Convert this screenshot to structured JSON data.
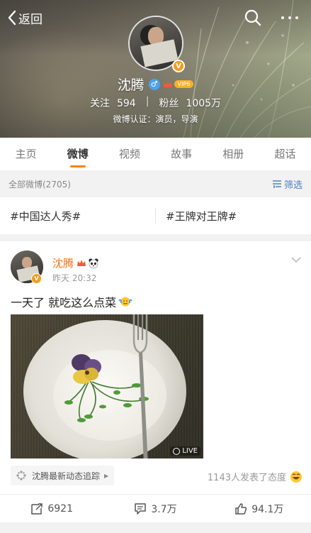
{
  "header": {
    "back_label": "返回",
    "profile_name": "沈腾",
    "gender_symbol": "♂",
    "vip_label": "VIP6",
    "following_label": "关注",
    "following_count": "594",
    "separator": "|",
    "followers_label": "粉丝",
    "followers_count": "1005万",
    "verification": "微博认证：演员，导演"
  },
  "tabs": [
    "主页",
    "微博",
    "视频",
    "故事",
    "相册",
    "超话"
  ],
  "active_tab": "微博",
  "filter": {
    "count_label": "全部微博(2705)",
    "filter_label": "筛选"
  },
  "topics": [
    "#中国达人秀#",
    "#王牌对王牌#"
  ],
  "post": {
    "author": "沈腾",
    "time": "昨天 20:32",
    "text": "一天了 就吃这么点菜",
    "live_label": "LIVE",
    "tracker_label": "沈腾最新动态追踪",
    "attitude_text": "1143人发表了态度",
    "repost_count": "6921",
    "comment_count": "3.7万",
    "like_count": "94.1万"
  },
  "colors": {
    "accent_orange": "#ff8200",
    "name_orange": "#f3730e",
    "link_blue": "#4a7ec5",
    "verified_badge": "#f29d1f"
  },
  "icons": [
    "chevron-left-icon",
    "search-icon",
    "more-icon",
    "verified-v-icon",
    "gender-male-icon",
    "crown-icon",
    "filter-icon",
    "chevron-down-icon",
    "live-photo-icon",
    "tracker-icon",
    "laugh-emoji-icon",
    "repost-icon",
    "comment-icon",
    "like-icon"
  ]
}
